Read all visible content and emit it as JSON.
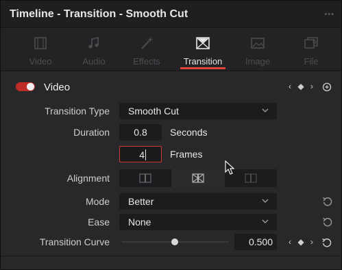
{
  "window": {
    "title": "Timeline - Transition - Smooth Cut",
    "more_label": "•••"
  },
  "tabs": [
    {
      "label": "Video",
      "icon": "film-icon",
      "active": false
    },
    {
      "label": "Audio",
      "icon": "music-note-icon",
      "active": false
    },
    {
      "label": "Effects",
      "icon": "magic-wand-icon",
      "active": false
    },
    {
      "label": "Transition",
      "icon": "transition-icon",
      "active": true
    },
    {
      "label": "Image",
      "icon": "image-icon",
      "active": false
    },
    {
      "label": "File",
      "icon": "file-icon",
      "active": false
    }
  ],
  "section": {
    "title": "Video",
    "enabled": true,
    "keyframe_nav": "‹ ◆ ›"
  },
  "fields": {
    "transition_type": {
      "label": "Transition Type",
      "value": "Smooth Cut"
    },
    "duration": {
      "label": "Duration",
      "seconds_value": "0.8",
      "seconds_unit": "Seconds",
      "frames_value": "4",
      "frames_unit": "Frames"
    },
    "alignment": {
      "label": "Alignment",
      "options": [
        "start-align-icon",
        "center-align-icon",
        "end-align-icon"
      ],
      "selected_index": 1
    },
    "mode": {
      "label": "Mode",
      "value": "Better"
    },
    "ease": {
      "label": "Ease",
      "value": "None"
    },
    "transition_curve": {
      "label": "Transition Curve",
      "value": "0.500",
      "slider_fraction": 0.5,
      "keyframe_nav": "‹ ◆ ›"
    }
  },
  "colors": {
    "accent": "#e0433b",
    "panel": "#28282a",
    "field": "#1c1c1e"
  }
}
